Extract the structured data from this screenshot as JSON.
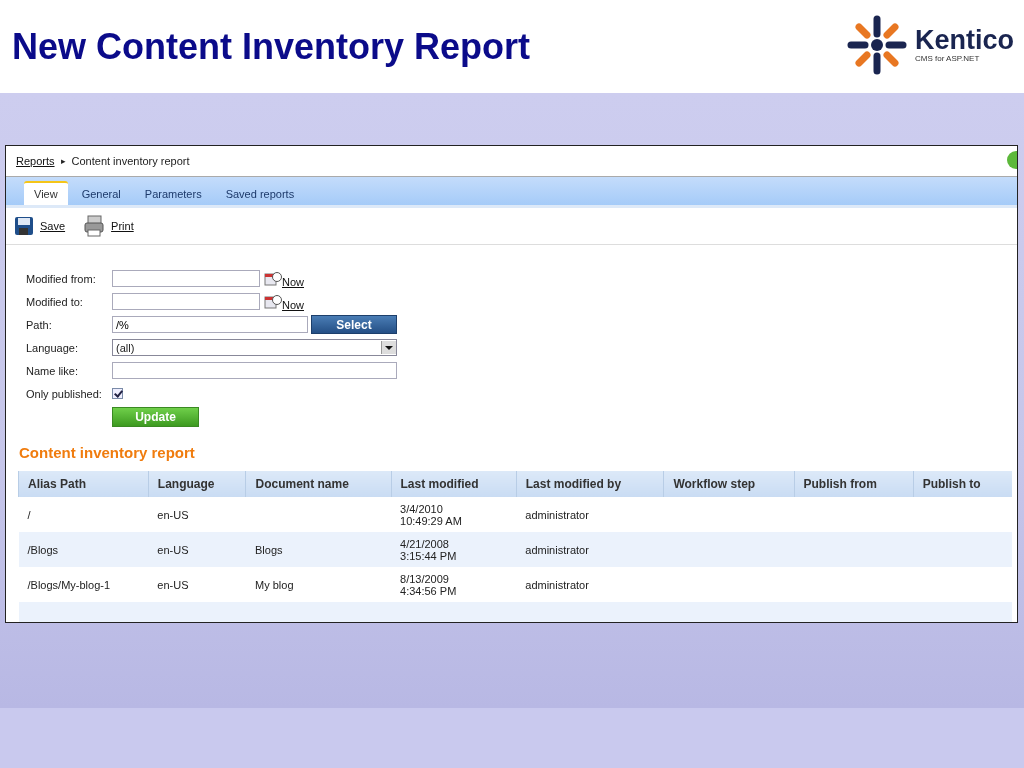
{
  "slide": {
    "title": "New Content Inventory Report",
    "logo": {
      "name": "Kentico",
      "tagline": "CMS for ASP.NET"
    }
  },
  "breadcrumb": {
    "link": "Reports",
    "separator": "▸",
    "current": "Content inventory report"
  },
  "tabs": [
    {
      "label": "View",
      "selected": true
    },
    {
      "label": "General",
      "selected": false
    },
    {
      "label": "Parameters",
      "selected": false
    },
    {
      "label": "Saved reports",
      "selected": false
    }
  ],
  "toolbar": [
    {
      "kind": "save",
      "label": "Save"
    },
    {
      "kind": "print",
      "label": "Print"
    }
  ],
  "form": [
    {
      "kind": "date",
      "label": "Modified from:",
      "link": "Now"
    },
    {
      "kind": "date",
      "label": "Modified to:",
      "link": "Now"
    },
    {
      "kind": "path",
      "label": "Path:",
      "value": "/%",
      "button": "Select"
    },
    {
      "kind": "select",
      "label": "Language:",
      "value": "(all)"
    },
    {
      "kind": "text",
      "label": "Name like:"
    },
    {
      "kind": "check",
      "label": "Only published:",
      "checked": true
    }
  ],
  "update_button": "Update",
  "report": {
    "title": "Content inventory report",
    "columns": [
      "Alias Path",
      "Language",
      "Document name",
      "Last modified",
      "Last modified by",
      "Workflow step",
      "Publish from",
      "Publish to"
    ],
    "rows": [
      [
        "/",
        "en-US",
        "",
        "3/4/2010\n10:49:29 AM",
        "administrator",
        "",
        "",
        ""
      ],
      [
        "/Blogs",
        "en-US",
        "Blogs",
        "4/21/2008\n3:15:44 PM",
        "administrator",
        "",
        "",
        ""
      ],
      [
        "/Blogs/My-blog-1",
        "en-US",
        "My blog",
        "8/13/2009\n4:34:56 PM",
        "administrator",
        "",
        "",
        ""
      ]
    ]
  }
}
